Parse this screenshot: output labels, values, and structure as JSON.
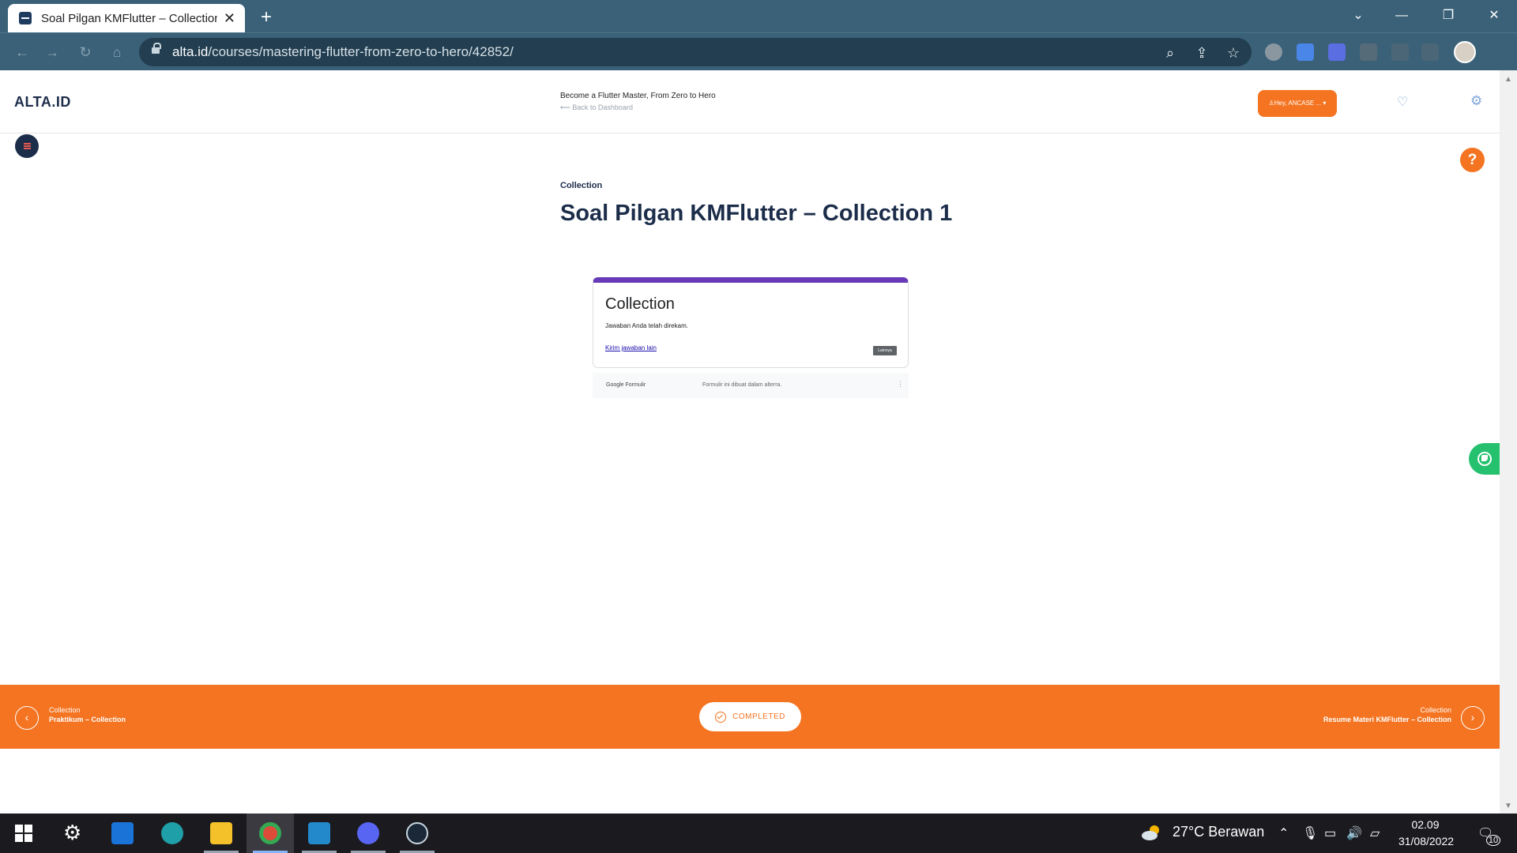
{
  "browser": {
    "tab_title": "Soal Pilgan KMFlutter – Collection",
    "url_host": "alta.id",
    "url_path": "/courses/mastering-flutter-from-zero-to-hero/42852/"
  },
  "header": {
    "logo": "ALTA.ID",
    "course_title": "Become a Flutter Master, From Zero to Hero",
    "back_link": "Back to Dashboard",
    "user_button": "Hey, ANCASE ..."
  },
  "lesson": {
    "section": "Collection",
    "title": "Soal Pilgan KMFlutter – Collection 1"
  },
  "form": {
    "heading": "Collection",
    "message": "Jawaban Anda telah direkam.",
    "link": "Kirim jawaban lain",
    "more_button": "Lainnya",
    "brand": "Google Formulir",
    "footer_note": "Formulir ini dibuat dalam alterra."
  },
  "lesson_nav": {
    "prev_section": "Collection",
    "prev_title": "Praktikum – Collection",
    "completed_label": "COMPLETED",
    "next_section": "Collection",
    "next_title": "Resume Materi KMFlutter – Collection"
  },
  "taskbar": {
    "weather": "27°C  Berawan",
    "time": "02.09",
    "date": "31/08/2022",
    "notifications": "10"
  },
  "colors": {
    "brand_navy": "#1c2d4a",
    "accent_orange": "#f47421",
    "form_purple": "#673ab7",
    "browser_frame": "#3a6178"
  }
}
